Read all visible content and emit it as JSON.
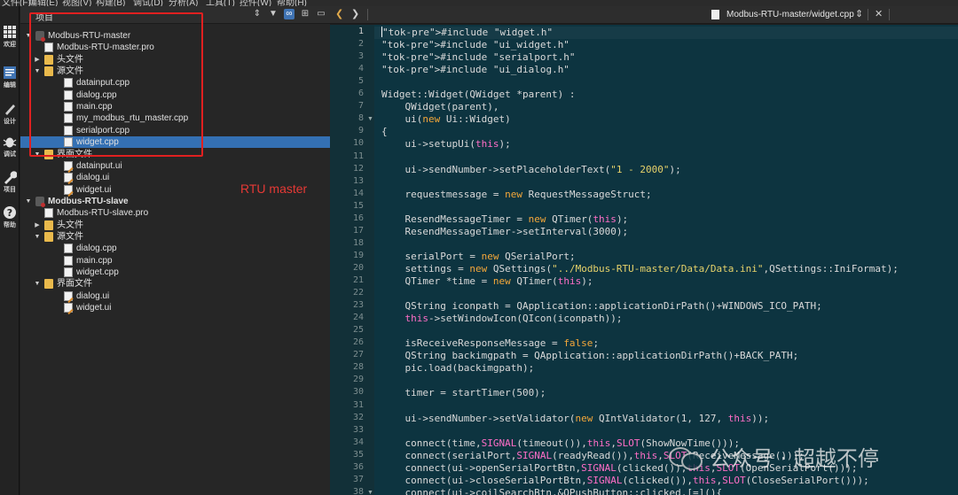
{
  "menubar": [
    "文件(F)",
    "编辑(E)",
    "视图(V)",
    "构建(B)",
    "调试(D)",
    "分析(A)",
    "工具(T)",
    "控件(W)",
    "帮助(H)"
  ],
  "modes": [
    {
      "label": "欢迎",
      "icon": "grid-icon"
    },
    {
      "label": "编辑",
      "icon": "edit-icon"
    },
    {
      "label": "设计",
      "icon": "pencil-icon"
    },
    {
      "label": "调试",
      "icon": "bug-icon"
    },
    {
      "label": "项目",
      "icon": "wrench-icon"
    },
    {
      "label": "帮助",
      "icon": "help-icon"
    }
  ],
  "tree_header": {
    "title": "项目"
  },
  "tree": [
    {
      "label": "Modbus-RTU-master",
      "type": "project",
      "expanded": true,
      "level": 0,
      "bold": false
    },
    {
      "label": "Modbus-RTU-master.pro",
      "type": "pro",
      "level": 1
    },
    {
      "label": "头文件",
      "type": "folder",
      "expanded": false,
      "level": 1
    },
    {
      "label": "源文件",
      "type": "folder",
      "expanded": true,
      "level": 1
    },
    {
      "label": "datainput.cpp",
      "type": "cpp",
      "level": 2
    },
    {
      "label": "dialog.cpp",
      "type": "cpp",
      "level": 2
    },
    {
      "label": "main.cpp",
      "type": "cpp",
      "level": 2
    },
    {
      "label": "my_modbus_rtu_master.cpp",
      "type": "cpp",
      "level": 2
    },
    {
      "label": "serialport.cpp",
      "type": "cpp",
      "level": 2
    },
    {
      "label": "widget.cpp",
      "type": "cpp",
      "level": 2,
      "selected": true
    },
    {
      "label": "界面文件",
      "type": "folder",
      "expanded": true,
      "level": 1
    },
    {
      "label": "datainput.ui",
      "type": "ui",
      "level": 2
    },
    {
      "label": "dialog.ui",
      "type": "ui",
      "level": 2
    },
    {
      "label": "widget.ui",
      "type": "ui",
      "level": 2
    },
    {
      "label": "Modbus-RTU-slave",
      "type": "project",
      "expanded": true,
      "level": 0,
      "bold": true
    },
    {
      "label": "Modbus-RTU-slave.pro",
      "type": "pro",
      "level": 1
    },
    {
      "label": "头文件",
      "type": "folder",
      "expanded": false,
      "level": 1
    },
    {
      "label": "源文件",
      "type": "folder",
      "expanded": true,
      "level": 1
    },
    {
      "label": "dialog.cpp",
      "type": "cpp",
      "level": 2
    },
    {
      "label": "main.cpp",
      "type": "cpp",
      "level": 2
    },
    {
      "label": "widget.cpp",
      "type": "cpp",
      "level": 2
    },
    {
      "label": "界面文件",
      "type": "folder",
      "expanded": true,
      "level": 1
    },
    {
      "label": "dialog.ui",
      "type": "ui",
      "level": 2
    },
    {
      "label": "widget.ui",
      "type": "ui",
      "level": 2
    }
  ],
  "annotation": "RTU master",
  "editor": {
    "filename": "Modbus-RTU-master/widget.cpp",
    "lines": [
      {
        "n": "1",
        "t": "#include \"widget.h\"",
        "k": "inc"
      },
      {
        "n": "2",
        "t": "#include \"ui_widget.h\"",
        "k": "inc"
      },
      {
        "n": "3",
        "t": "#include \"serialport.h\"",
        "k": "inc"
      },
      {
        "n": "4",
        "t": "#include \"ui_dialog.h\"",
        "k": "inc"
      },
      {
        "n": "5",
        "t": "",
        "k": "plain"
      },
      {
        "n": "6",
        "t": "Widget::Widget(QWidget *parent) :",
        "k": "plain"
      },
      {
        "n": "7",
        "t": "    QWidget(parent),",
        "k": "plain"
      },
      {
        "n": "8",
        "t": "    ui(new Ui::Widget)",
        "k": "new"
      },
      {
        "n": "9",
        "t": "{",
        "k": "plain"
      },
      {
        "n": "10",
        "t": "    ui->setupUi(this);",
        "k": "this"
      },
      {
        "n": "11",
        "t": "",
        "k": "plain"
      },
      {
        "n": "12",
        "t": "    ui->sendNumber->setPlaceholderText(\"1 - 2000\");",
        "k": "strcall"
      },
      {
        "n": "13",
        "t": "",
        "k": "plain"
      },
      {
        "n": "14",
        "t": "    requestmessage = new RequestMessageStruct;",
        "k": "new"
      },
      {
        "n": "15",
        "t": "",
        "k": "plain"
      },
      {
        "n": "16",
        "t": "    ResendMessageTimer = new QTimer(this);",
        "k": "newthis"
      },
      {
        "n": "17",
        "t": "    ResendMessageTimer->setInterval(3000);",
        "k": "plain"
      },
      {
        "n": "18",
        "t": "",
        "k": "plain"
      },
      {
        "n": "19",
        "t": "    serialPort = new QSerialPort;",
        "k": "new"
      },
      {
        "n": "20",
        "t": "    settings = new QSettings(\"../Modbus-RTU-master/Data/Data.ini\",QSettings::IniFormat);",
        "k": "newstr"
      },
      {
        "n": "21",
        "t": "    QTimer *time = new QTimer(this);",
        "k": "newthis"
      },
      {
        "n": "22",
        "t": "",
        "k": "plain"
      },
      {
        "n": "23",
        "t": "    QString iconpath = QApplication::applicationDirPath()+WINDOWS_ICO_PATH;",
        "k": "plain"
      },
      {
        "n": "24",
        "t": "    this->setWindowIcon(QIcon(iconpath));",
        "k": "this"
      },
      {
        "n": "25",
        "t": "",
        "k": "plain"
      },
      {
        "n": "26",
        "t": "    isReceiveResponseMessage = false;",
        "k": "false"
      },
      {
        "n": "27",
        "t": "    QString backimgpath = QApplication::applicationDirPath()+BACK_PATH;",
        "k": "plain"
      },
      {
        "n": "28",
        "t": "    pic.load(backimgpath);",
        "k": "plain"
      },
      {
        "n": "29",
        "t": "",
        "k": "plain"
      },
      {
        "n": "30",
        "t": "    timer = startTimer(500);",
        "k": "plain"
      },
      {
        "n": "31",
        "t": "",
        "k": "plain"
      },
      {
        "n": "32",
        "t": "    ui->sendNumber->setValidator(new QIntValidator(1, 127, this));",
        "k": "newthis"
      },
      {
        "n": "33",
        "t": "",
        "k": "plain"
      },
      {
        "n": "34",
        "t": "    connect(time,SIGNAL(timeout()),this,SLOT(ShowNowTime()));",
        "k": "sig"
      },
      {
        "n": "35",
        "t": "    connect(serialPort,SIGNAL(readyRead()),this,SLOT(ReceiveMessage()));",
        "k": "sig"
      },
      {
        "n": "36",
        "t": "    connect(ui->openSerialPortBtn,SIGNAL(clicked()),this,SLOT(OpenSerialPort()));",
        "k": "sig"
      },
      {
        "n": "37",
        "t": "    connect(ui->closeSerialPortBtn,SIGNAL(clicked()),this,SLOT(CloseSerialPort()));",
        "k": "sig"
      },
      {
        "n": "38",
        "t": "    connect(ui->coilSearchBtn,&QPushButton::clicked,[=](){",
        "k": "plain"
      }
    ]
  },
  "watermark": "公众号 · 超越不停",
  "colors": {
    "accent": "#3470b3",
    "annotation": "#e53935",
    "editor_bg": "#0d3440"
  }
}
